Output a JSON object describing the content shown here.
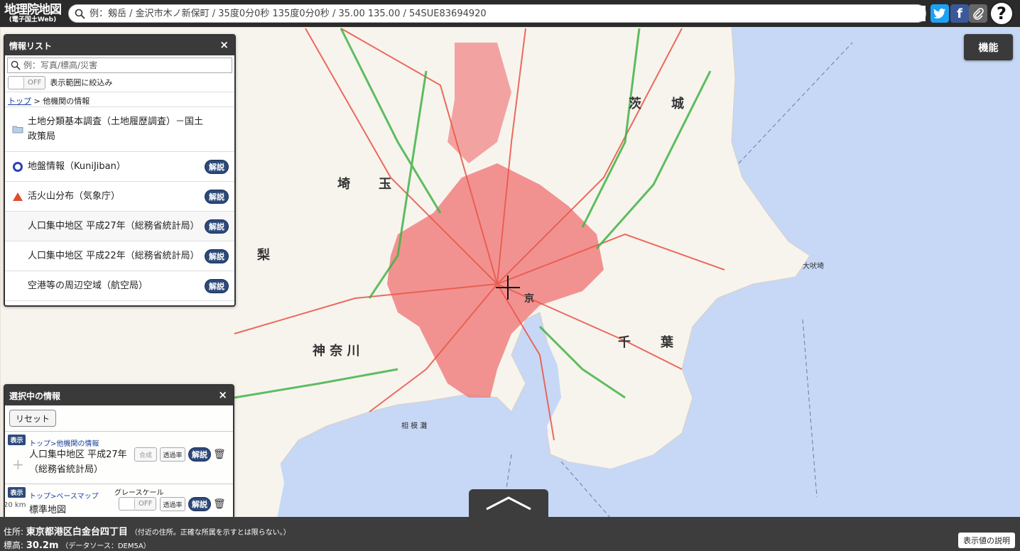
{
  "header": {
    "logo_line1": "地理院地図",
    "logo_line2": "(電子国土Web)",
    "search_placeholder": "例：剱岳 / 金沢市木ノ新保町 / 35度0分0秒 135度0分0秒 / 35.00 135.00 / 54SUE83694920",
    "icons": [
      "search-icon",
      "twitter-icon",
      "facebook-icon",
      "link-icon",
      "help-icon"
    ]
  },
  "function_button": "機能",
  "info_panel": {
    "title": "情報リスト",
    "search_placeholder": "例：写真/標高/災害",
    "toggle_state": "OFF",
    "toggle_label": "表示範囲に絞込み",
    "breadcrumb_link": "トップ",
    "breadcrumb_rest": " > 他機関の情報",
    "items": [
      {
        "label": "土地分類基本調査（土地履歴調査）－国土政策局",
        "icon": "folder-icon",
        "has_button": false
      },
      {
        "label": "地盤情報（KuniJiban）",
        "icon": "circle-icon",
        "has_button": true
      },
      {
        "label": "活火山分布（気象庁）",
        "icon": "triangle-icon",
        "has_button": true
      },
      {
        "label": "人口集中地区 平成27年（総務省統計局）",
        "icon": "",
        "has_button": true
      },
      {
        "label": "人口集中地区 平成22年（総務省統計局）",
        "icon": "",
        "has_button": true
      },
      {
        "label": "空港等の周辺空域（航空局）",
        "icon": "",
        "has_button": true
      }
    ],
    "explain_label": "解説",
    "close": "×"
  },
  "selected_panel": {
    "title": "選択中の情報",
    "reset": "リセット",
    "close": "×",
    "rows": [
      {
        "badge": "表示",
        "path": "トップ>他機関の情報",
        "name": "人口集中地区 平成27年（総務省統計局）",
        "btn1": "合成",
        "btn2": "透過率",
        "explain": "解説"
      },
      {
        "badge": "表示",
        "path": "トップ>ベースマップ",
        "name": "標準地図",
        "grayscale": "グレースケール",
        "toggle": "OFF",
        "btn2": "透過率",
        "explain": "解説"
      }
    ]
  },
  "status_bar": {
    "address_label": "住所:",
    "address_value": "東京都港区白金台四丁目",
    "address_note": "（付近の住所。正確な所属を示すとは限らない。）",
    "elevation_label": "標高:",
    "elevation_value": "30.2m",
    "elevation_note": "（データソース：DEM5A）",
    "explain_button": "表示値の説明"
  },
  "scale_text": "20 km",
  "map_labels": [
    {
      "text": "茨",
      "id": "pref-ibaraki-1"
    },
    {
      "text": "城",
      "id": "pref-ibaraki-2"
    },
    {
      "text": "埼",
      "id": "pref-saitama-1"
    },
    {
      "text": "玉",
      "id": "pref-saitama-2"
    },
    {
      "text": "神 奈 川",
      "id": "pref-kanagawa"
    },
    {
      "text": "千",
      "id": "pref-chiba-1"
    },
    {
      "text": "葉",
      "id": "pref-chiba-2"
    },
    {
      "text": "京",
      "id": "pref-tokyo"
    },
    {
      "text": "梨",
      "id": "pref-yamanashi"
    },
    {
      "text": "相 模 灘",
      "id": "sea-sagami"
    },
    {
      "text": "大吠埼",
      "id": "cape-inubo"
    }
  ],
  "colors": {
    "sea": "#c6d8f6",
    "land": "#f7f4ee",
    "urban": "#f08080",
    "road": "#ea5a4a",
    "highway": "#43b346",
    "header": "#2b2b2b",
    "badge": "#2d4a7a"
  }
}
